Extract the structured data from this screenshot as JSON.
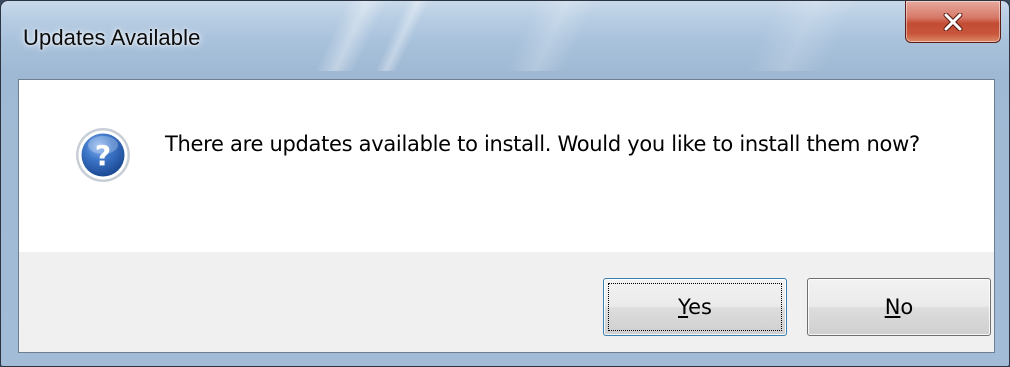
{
  "window": {
    "title": "Updates Available",
    "close_icon": "close-x-icon"
  },
  "dialog": {
    "icon": "question-icon",
    "message": "There are updates available to install. Would you like to install them now?"
  },
  "buttons": {
    "yes": {
      "accel": "Y",
      "rest": "es",
      "default": true
    },
    "no": {
      "accel": "N",
      "rest": "o",
      "default": false
    }
  },
  "colors": {
    "titlebar": "#b7cde3",
    "close_button": "#c24b33",
    "question_icon": "#2a5fb0",
    "button_area": "#f0f0f0",
    "content_area": "#ffffff"
  }
}
